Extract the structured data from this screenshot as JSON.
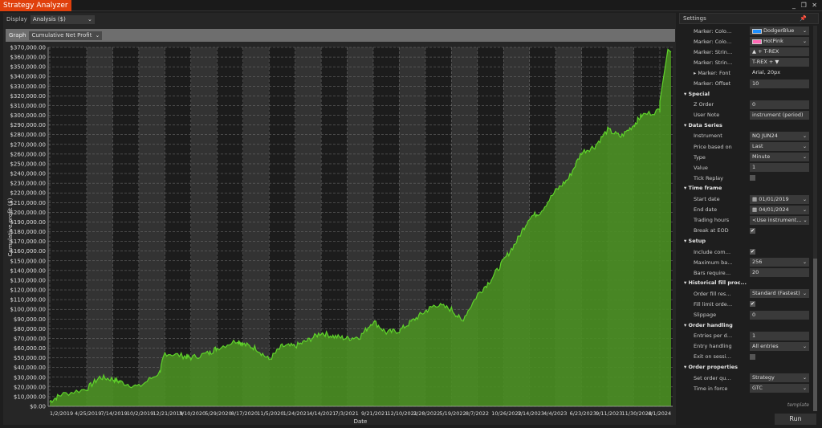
{
  "window": {
    "title": "Strategy Analyzer",
    "controls": "_ ❐ ✕"
  },
  "toolbar": {
    "display_label": "Display",
    "display_value": "Analysis ($)",
    "graph_label": "Graph",
    "graph_value": "Cumulative Net Profit"
  },
  "chart_data": {
    "type": "area",
    "title": "Cumulative Net Profit",
    "xlabel": "Date",
    "ylabel": "Cumulative profit ($)",
    "ylim": [
      0,
      370000
    ],
    "x_ticks": [
      "1/2/2019",
      "4/25/2019",
      "7/14/2019",
      "10/2/2019",
      "12/21/2019",
      "3/10/2020",
      "5/29/2020",
      "8/17/2020",
      "11/5/2020",
      "1/24/2021",
      "4/14/2021",
      "7/3/2021",
      "9/21/2021",
      "12/10/2021",
      "2/28/2022",
      "5/19/2022",
      "8/7/2022",
      "10/26/2022",
      "1/14/2023",
      "4/4/2023",
      "6/23/2023",
      "9/11/2023",
      "11/30/2023",
      "4/1/2024"
    ],
    "y_ticks": [
      "$0.00",
      "$10,000.00",
      "$20,000.00",
      "$30,000.00",
      "$40,000.00",
      "$50,000.00",
      "$60,000.00",
      "$70,000.00",
      "$80,000.00",
      "$90,000.00",
      "$100,000.00",
      "$110,000.00",
      "$120,000.00",
      "$130,000.00",
      "$140,000.00",
      "$150,000.00",
      "$160,000.00",
      "$170,000.00",
      "$180,000.00",
      "$190,000.00",
      "$200,000.00",
      "$210,000.00",
      "$220,000.00",
      "$230,000.00",
      "$240,000.00",
      "$250,000.00",
      "$260,000.00",
      "$270,000.00",
      "$280,000.00",
      "$290,000.00",
      "$300,000.00",
      "$310,000.00",
      "$320,000.00",
      "$330,000.00",
      "$340,000.00",
      "$350,000.00",
      "$360,000.00",
      "$370,000.00"
    ],
    "series": [
      {
        "name": "Cumulative Net Profit",
        "color": "#5fd32a",
        "fill": "#4a8f22",
        "x": [
          0,
          0.3,
          1,
          1.5,
          2,
          2.3,
          3,
          3.8,
          4,
          4.7,
          5,
          5.7,
          6,
          6.8,
          7,
          7.5,
          8,
          8.5,
          9,
          9.5,
          10,
          10.5,
          11,
          11.5,
          12,
          12.5,
          13,
          13.5,
          14,
          14.4,
          15,
          15.4,
          16,
          16.5,
          17,
          17.5,
          18,
          18.4,
          19,
          19.5,
          20,
          20.5,
          21,
          21.5,
          22,
          22.3,
          23,
          23.5
        ],
        "y": [
          5000,
          12000,
          18000,
          30000,
          28000,
          25000,
          20000,
          35000,
          55000,
          52000,
          50000,
          55000,
          60000,
          68000,
          64000,
          60000,
          48000,
          62000,
          62000,
          68000,
          76000,
          72000,
          70000,
          72000,
          88000,
          76000,
          78000,
          88000,
          98000,
          105000,
          100000,
          88000,
          115000,
          130000,
          150000,
          170000,
          195000,
          200000,
          222000,
          235000,
          262000,
          268000,
          285000,
          278000,
          290000,
          300000,
          305000,
          315000
        ]
      }
    ]
  },
  "settings": {
    "title": "Settings",
    "pin": "📌",
    "rows": [
      {
        "t": "row",
        "label": "Marker: Color Bull...",
        "value": "DodgerBlue",
        "swatch": "#1e90ff",
        "dd": true
      },
      {
        "t": "row",
        "label": "Marker: Color Bea...",
        "value": "HotPink",
        "swatch": "#ff69b4",
        "dd": true
      },
      {
        "t": "row",
        "label": "Marker: String Up...",
        "value": "▲ + T-REX"
      },
      {
        "t": "row",
        "label": "Marker: String Do...",
        "value": "T-REX + ▼"
      },
      {
        "t": "row",
        "label": "▸  Marker: Font",
        "value": "Arial, 20px",
        "plain": true
      },
      {
        "t": "row",
        "label": "Marker: Offset",
        "value": "10"
      },
      {
        "t": "cat",
        "label": "▾  Special"
      },
      {
        "t": "row",
        "label": "Z Order",
        "value": "0"
      },
      {
        "t": "row",
        "label": "User Note",
        "value": "instrument (period)"
      },
      {
        "t": "cat",
        "label": "▾  Data Series"
      },
      {
        "t": "row",
        "label": "Instrument",
        "value": "NQ JUN24",
        "dd": true
      },
      {
        "t": "row",
        "label": "Price based on",
        "value": "Last",
        "dd": true
      },
      {
        "t": "row",
        "label": "Type",
        "value": "Minute",
        "dd": true
      },
      {
        "t": "row",
        "label": "Value",
        "value": "1"
      },
      {
        "t": "chk",
        "label": "Tick Replay",
        "checked": ""
      },
      {
        "t": "cat",
        "label": "▾  Time frame"
      },
      {
        "t": "row",
        "label": "Start date",
        "value": "▦ 01/01/2019",
        "dd": true
      },
      {
        "t": "row",
        "label": "End date",
        "value": "▦ 04/01/2024",
        "dd": true
      },
      {
        "t": "row",
        "label": "Trading hours",
        "value": "<Use instrument...",
        "dd": true
      },
      {
        "t": "chk",
        "label": "Break at EOD",
        "checked": "✔"
      },
      {
        "t": "cat",
        "label": "▾  Setup"
      },
      {
        "t": "chk",
        "label": "Include commissi...",
        "checked": "✔"
      },
      {
        "t": "row",
        "label": "Maximum bars lo...",
        "value": "256",
        "dd": true
      },
      {
        "t": "row",
        "label": "Bars required to t...",
        "value": "20"
      },
      {
        "t": "cat",
        "label": "▾  Historical fill proc..."
      },
      {
        "t": "row",
        "label": "Order fill resolution",
        "value": "Standard (Fastest)",
        "dd": true
      },
      {
        "t": "chk",
        "label": "Fill limit orders on...",
        "checked": "✔"
      },
      {
        "t": "row",
        "label": "Slippage",
        "value": "0"
      },
      {
        "t": "cat",
        "label": "▾  Order handling"
      },
      {
        "t": "row",
        "label": "Entries per directi...",
        "value": "1"
      },
      {
        "t": "row",
        "label": "Entry handling",
        "value": "All entries",
        "dd": true
      },
      {
        "t": "chk",
        "label": "Exit on session clo...",
        "checked": ""
      },
      {
        "t": "cat",
        "label": "▾  Order properties"
      },
      {
        "t": "row",
        "label": "Set order quantity",
        "value": "Strategy",
        "dd": true
      },
      {
        "t": "row",
        "label": "Time in force",
        "value": "GTC",
        "dd": true
      }
    ],
    "template_link": "template",
    "run_label": "Run"
  }
}
